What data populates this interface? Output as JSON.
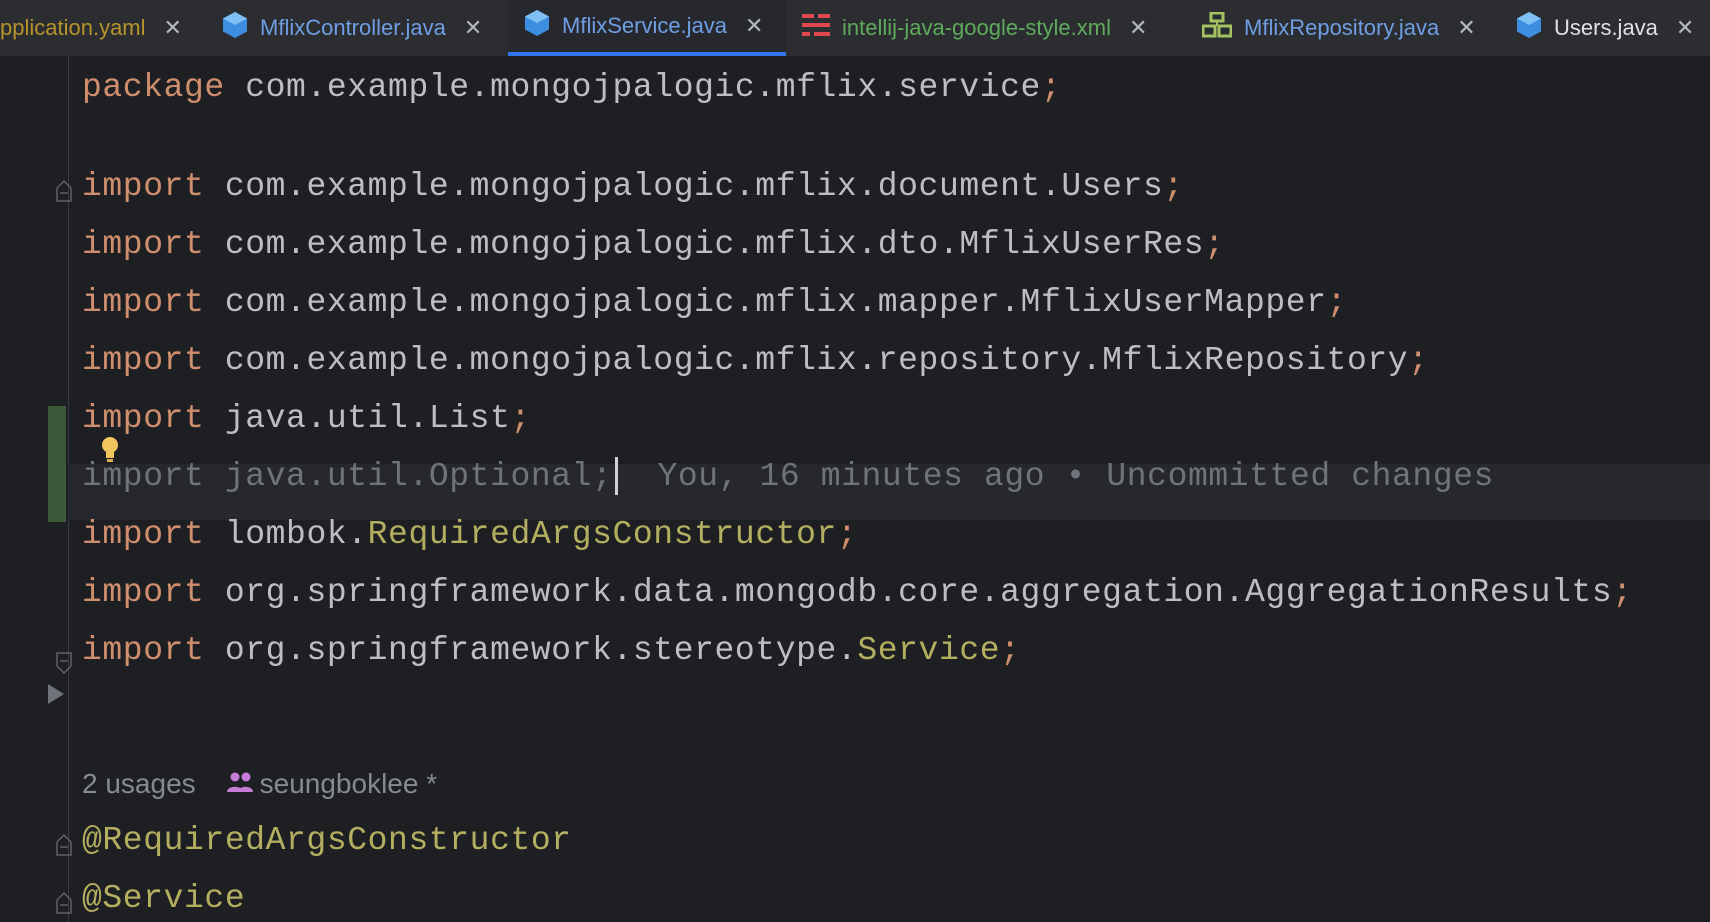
{
  "colors": {
    "background": "#1e1f22",
    "tabbar_bg": "#2b2d30",
    "active_tab_underline": "#3574f0",
    "keyword": "#cf8e6d",
    "annotation": "#b3ae60",
    "text": "#bcbec4",
    "muted": "#6f737a",
    "vcs_added": "#3c5a3a"
  },
  "tabs": [
    {
      "label": "pplication.yaml",
      "icon": "yaml-file-icon",
      "color": "#b6932b",
      "active": false
    },
    {
      "label": "MflixController.java",
      "icon": "java-class-icon",
      "color": "#6f9ee5",
      "active": false
    },
    {
      "label": "MflixService.java",
      "icon": "java-class-icon",
      "color": "#6f9ee5",
      "active": true
    },
    {
      "label": "intellij-java-google-style.xml",
      "icon": "xml-file-icon",
      "color": "#5fab5c",
      "active": false
    },
    {
      "label": "MflixRepository.java",
      "icon": "java-interface-icon",
      "color": "#6f9ee5",
      "active": false
    },
    {
      "label": "Users.java",
      "icon": "java-class-icon",
      "color": "#dfe1e5",
      "active": false
    }
  ],
  "code": {
    "package_kw": "package",
    "package_name": " com.example.mongojpalogic.mflix.service",
    "import_kw": "import",
    "semicolon": ";",
    "imports": [
      {
        "path": " com.example.mongojpalogic.mflix.document.Users",
        "highlight": ""
      },
      {
        "path": " com.example.mongojpalogic.mflix.dto.MflixUserRes",
        "highlight": ""
      },
      {
        "path": " com.example.mongojpalogic.mflix.mapper.MflixUserMapper",
        "highlight": ""
      },
      {
        "path": " com.example.mongojpalogic.mflix.repository.MflixRepository",
        "highlight": ""
      },
      {
        "path": " java.util.List",
        "highlight": ""
      },
      {
        "path": " java.util.Optional",
        "highlight": ""
      },
      {
        "path": " lombok.",
        "highlight": "RequiredArgsConstructor"
      },
      {
        "path": " org.springframework.data.mongodb.core.aggregation.AggregationResults",
        "highlight": ""
      },
      {
        "path": " org.springframework.stereotype.",
        "highlight": "Service"
      }
    ],
    "blame": "You, 16 minutes ago • Uncommitted changes",
    "usages": "2 usages",
    "author": "seungboklee *",
    "annotation_1": "@RequiredArgsConstructor",
    "annotation_2": "@Service"
  }
}
